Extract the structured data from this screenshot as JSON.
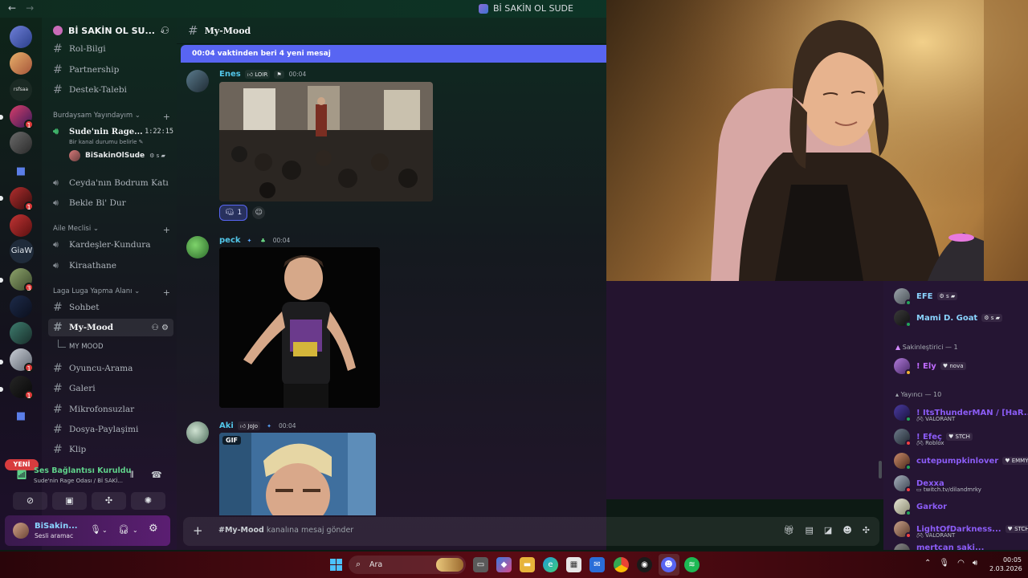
{
  "window": {
    "title": "Bİ SAKİN OL SUDE"
  },
  "guild": {
    "name": "Bİ SAKİN OL SU..."
  },
  "sidebar": {
    "channels_top": [
      {
        "name": "Rol-Bilgi"
      },
      {
        "name": "Partnership"
      },
      {
        "name": "Destek-Talebi"
      }
    ],
    "category1": "Burdaysam Yayındayım",
    "voice_live": {
      "name": "Sude'nin Rage...",
      "timer": "1:22:15",
      "status": "Bir kanal durumu belirle",
      "user": "BiSakinOlSude"
    },
    "voice_channels": [
      {
        "name": "Ceyda'nın Bodrum Katı"
      },
      {
        "name": "Bekle Bi' Dur"
      }
    ],
    "category2": "Aile Meclisi",
    "channels_mid": [
      {
        "name": "Kardeşler-Kundura"
      },
      {
        "name": "Kiraathane"
      }
    ],
    "category3": "Laga Luga Yapma Alanı",
    "channels_bottom": [
      {
        "name": "Sohbet"
      },
      {
        "name": "My-Mood"
      },
      {
        "name": "MY MOOD"
      },
      {
        "name": "Oyuncu-Arama"
      },
      {
        "name": "Galeri"
      },
      {
        "name": "Mikrofonsuzlar"
      },
      {
        "name": "Dosya-Paylaşimi"
      },
      {
        "name": "Klip"
      }
    ]
  },
  "rail": {
    "giaw": "GiaW",
    "new_label": "YENİ",
    "badges": [
      "1",
      "1",
      "3",
      "1",
      "1"
    ]
  },
  "voice_panel": {
    "connected": "Ses Bağlantısı Kuruldu",
    "location": "Sude'nin Rage Odası / Bİ SAKİ..."
  },
  "user_panel": {
    "name": "BiSakin...",
    "status": "Sesli aramac"
  },
  "chat": {
    "channel": "My-Mood",
    "new_messages": "00:04 vaktinden beri 4 yeni mesaj",
    "messages": [
      {
        "author": "Enes",
        "tag": "LOIR",
        "time": "00:04",
        "color": "#52c6e8",
        "reaction_count": "1"
      },
      {
        "author": "peck",
        "tag": "",
        "time": "00:04",
        "color": "#52c6e8"
      },
      {
        "author": "Aki",
        "tag": "JoJo",
        "time": "00:04",
        "color": "#52c6e8",
        "gif": "GIF"
      }
    ],
    "composer_channel": "#My-Mood",
    "composer_suffix": " kanalına mesaj gönder"
  },
  "members": {
    "top": [
      {
        "name": "EFE",
        "color": "#8ad4ff"
      },
      {
        "name": "Mami D. Goat",
        "color": "#8ad4ff"
      }
    ],
    "group1": "Sakinleştirici — 1",
    "group1_members": [
      {
        "name": "! Ely",
        "tag": "nova",
        "color": "#c06bff"
      }
    ],
    "group2": "Yayıncı — 10",
    "group2_members": [
      {
        "name": "! ItsThunderMAN / [HaR...",
        "activity": "VALORANT",
        "color": "#8b5cf6"
      },
      {
        "name": "! Efeç",
        "tag": "STCH",
        "activity": "Roblox",
        "color": "#8b5cf6"
      },
      {
        "name": "cutepumpkinlover",
        "tag": "EMMY",
        "activity": "",
        "color": "#8b5cf6"
      },
      {
        "name": "Dexxa",
        "activity": "twitch.tv/dilandmrky",
        "color": "#8b5cf6"
      },
      {
        "name": "Garkor",
        "activity": "",
        "color": "#8b5cf6"
      },
      {
        "name": "LightOfDarkness...",
        "tag": "STCH",
        "activity": "VALORANT",
        "color": "#8b5cf6"
      },
      {
        "name": "mertcan saki...",
        "activity": "",
        "color": "#8b5cf6"
      }
    ]
  },
  "taskbar": {
    "search": "Ara",
    "time": "00:05",
    "date": "2.03.2026"
  }
}
